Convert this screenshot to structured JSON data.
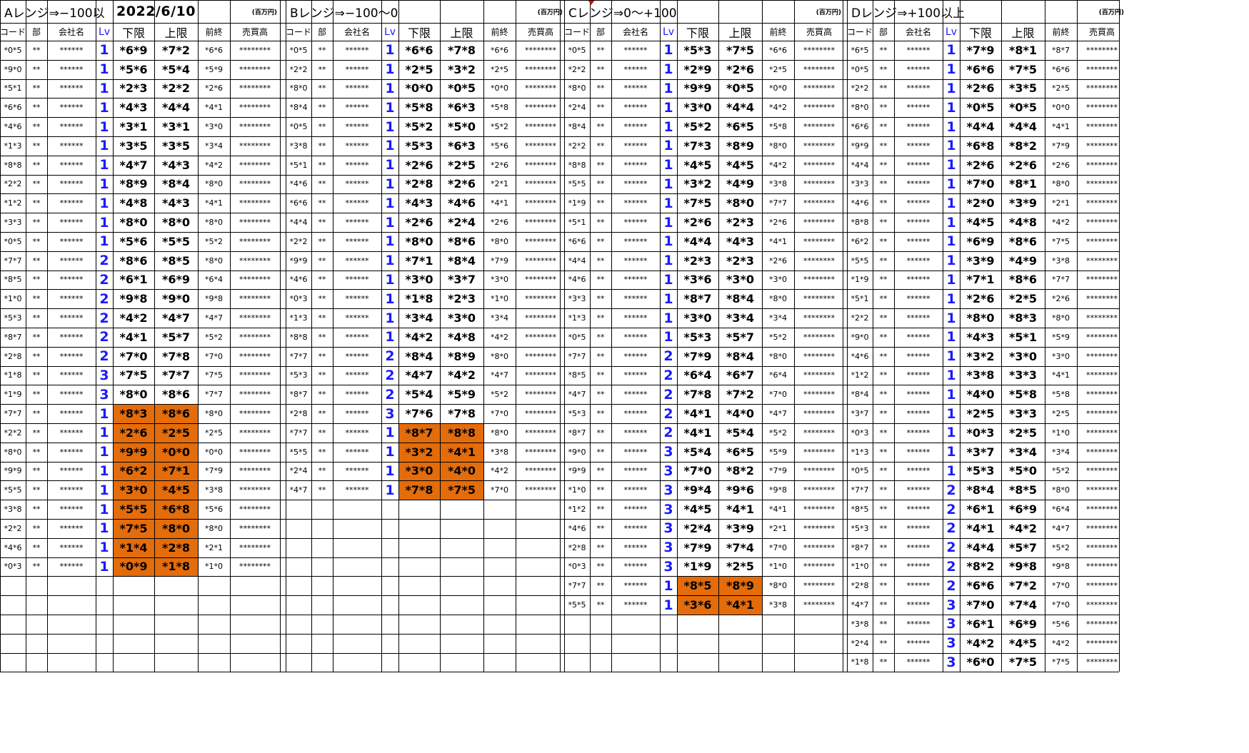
{
  "date": "2022/6/10",
  "unit_label": "(百万円)",
  "columns": [
    "コード",
    "部",
    "会社名",
    "Lv",
    "下限",
    "上限",
    "前終",
    "売買高"
  ],
  "colors": {
    "highlight": "#e46c0a",
    "lv": "#1a1aff",
    "marker": "#e00000"
  },
  "sections": [
    {
      "title": "Aレンジ⇒−100以",
      "rows": [
        [
          "*0*5",
          "**",
          "******",
          "1",
          "*6*9",
          "*7*2",
          "*6*6",
          "********"
        ],
        [
          "*9*0",
          "**",
          "******",
          "1",
          "*5*6",
          "*5*4",
          "*5*9",
          "********"
        ],
        [
          "*5*1",
          "**",
          "******",
          "1",
          "*2*3",
          "*2*2",
          "*2*6",
          "********"
        ],
        [
          "*6*6",
          "**",
          "******",
          "1",
          "*4*3",
          "*4*4",
          "*4*1",
          "********"
        ],
        [
          "*4*6",
          "**",
          "******",
          "1",
          "*3*1",
          "*3*1",
          "*3*0",
          "********"
        ],
        [
          "*1*3",
          "**",
          "******",
          "1",
          "*3*5",
          "*3*5",
          "*3*4",
          "********"
        ],
        [
          "*8*8",
          "**",
          "******",
          "1",
          "*4*7",
          "*4*3",
          "*4*2",
          "********"
        ],
        [
          "*2*2",
          "**",
          "******",
          "1",
          "*8*9",
          "*8*4",
          "*8*0",
          "********"
        ],
        [
          "*1*2",
          "**",
          "******",
          "1",
          "*4*8",
          "*4*3",
          "*4*1",
          "********"
        ],
        [
          "*3*3",
          "**",
          "******",
          "1",
          "*8*0",
          "*8*0",
          "*8*0",
          "********"
        ],
        [
          "*0*5",
          "**",
          "******",
          "1",
          "*5*6",
          "*5*5",
          "*5*2",
          "********"
        ],
        [
          "*7*7",
          "**",
          "******",
          "2",
          "*8*6",
          "*8*5",
          "*8*0",
          "********"
        ],
        [
          "*8*5",
          "**",
          "******",
          "2",
          "*6*1",
          "*6*9",
          "*6*4",
          "********"
        ],
        [
          "*1*0",
          "**",
          "******",
          "2",
          "*9*8",
          "*9*0",
          "*9*8",
          "********"
        ],
        [
          "*5*3",
          "**",
          "******",
          "2",
          "*4*2",
          "*4*7",
          "*4*7",
          "********"
        ],
        [
          "*8*7",
          "**",
          "******",
          "2",
          "*4*1",
          "*5*7",
          "*5*2",
          "********"
        ],
        [
          "*2*8",
          "**",
          "******",
          "2",
          "*7*0",
          "*7*8",
          "*7*0",
          "********"
        ],
        [
          "*1*8",
          "**",
          "******",
          "3",
          "*7*5",
          "*7*7",
          "*7*5",
          "********"
        ],
        [
          "*1*9",
          "**",
          "******",
          "3",
          "*8*0",
          "*8*6",
          "*7*7",
          "********"
        ],
        [
          "*7*7",
          "**",
          "******",
          "1",
          "*8*3",
          "*8*6",
          "*8*0",
          "********",
          true
        ],
        [
          "*2*2",
          "**",
          "******",
          "1",
          "*2*6",
          "*2*5",
          "*2*5",
          "********",
          true
        ],
        [
          "*8*0",
          "**",
          "******",
          "1",
          "*9*9",
          "*0*0",
          "*0*0",
          "********",
          true
        ],
        [
          "*9*9",
          "**",
          "******",
          "1",
          "*6*2",
          "*7*1",
          "*7*9",
          "********",
          true
        ],
        [
          "*5*5",
          "**",
          "******",
          "1",
          "*3*0",
          "*4*5",
          "*3*8",
          "********",
          true
        ],
        [
          "*3*8",
          "**",
          "******",
          "1",
          "*5*5",
          "*6*8",
          "*5*6",
          "********",
          true
        ],
        [
          "*2*2",
          "**",
          "******",
          "1",
          "*7*5",
          "*8*0",
          "*8*0",
          "********",
          true
        ],
        [
          "*4*6",
          "**",
          "******",
          "1",
          "*1*4",
          "*2*8",
          "*2*1",
          "********",
          true
        ],
        [
          "*0*3",
          "**",
          "******",
          "1",
          "*0*9",
          "*1*8",
          "*1*0",
          "********",
          true
        ]
      ]
    },
    {
      "title": "Bレンジ⇒−100〜0",
      "rows": [
        [
          "*0*5",
          "**",
          "******",
          "1",
          "*6*6",
          "*7*8",
          "*6*6",
          "********"
        ],
        [
          "*2*2",
          "**",
          "******",
          "1",
          "*2*5",
          "*3*2",
          "*2*5",
          "********"
        ],
        [
          "*8*0",
          "**",
          "******",
          "1",
          "*0*0",
          "*0*5",
          "*0*0",
          "********"
        ],
        [
          "*8*4",
          "**",
          "******",
          "1",
          "*5*8",
          "*6*3",
          "*5*8",
          "********"
        ],
        [
          "*0*5",
          "**",
          "******",
          "1",
          "*5*2",
          "*5*0",
          "*5*2",
          "********"
        ],
        [
          "*3*8",
          "**",
          "******",
          "1",
          "*5*3",
          "*6*3",
          "*5*6",
          "********"
        ],
        [
          "*5*1",
          "**",
          "******",
          "1",
          "*2*6",
          "*2*5",
          "*2*6",
          "********"
        ],
        [
          "*4*6",
          "**",
          "******",
          "1",
          "*2*8",
          "*2*6",
          "*2*1",
          "********"
        ],
        [
          "*6*6",
          "**",
          "******",
          "1",
          "*4*3",
          "*4*6",
          "*4*1",
          "********"
        ],
        [
          "*4*4",
          "**",
          "******",
          "1",
          "*2*6",
          "*2*4",
          "*2*6",
          "********"
        ],
        [
          "*2*2",
          "**",
          "******",
          "1",
          "*8*0",
          "*8*6",
          "*8*0",
          "********"
        ],
        [
          "*9*9",
          "**",
          "******",
          "1",
          "*7*1",
          "*8*4",
          "*7*9",
          "********"
        ],
        [
          "*4*6",
          "**",
          "******",
          "1",
          "*3*0",
          "*3*7",
          "*3*0",
          "********"
        ],
        [
          "*0*3",
          "**",
          "******",
          "1",
          "*1*8",
          "*2*3",
          "*1*0",
          "********"
        ],
        [
          "*1*3",
          "**",
          "******",
          "1",
          "*3*4",
          "*3*0",
          "*3*4",
          "********"
        ],
        [
          "*8*8",
          "**",
          "******",
          "1",
          "*4*2",
          "*4*8",
          "*4*2",
          "********"
        ],
        [
          "*7*7",
          "**",
          "******",
          "2",
          "*8*4",
          "*8*9",
          "*8*0",
          "********"
        ],
        [
          "*5*3",
          "**",
          "******",
          "2",
          "*4*7",
          "*4*2",
          "*4*7",
          "********"
        ],
        [
          "*8*7",
          "**",
          "******",
          "2",
          "*5*4",
          "*5*9",
          "*5*2",
          "********"
        ],
        [
          "*2*8",
          "**",
          "******",
          "3",
          "*7*6",
          "*7*8",
          "*7*0",
          "********"
        ],
        [
          "*7*7",
          "**",
          "******",
          "1",
          "*8*7",
          "*8*8",
          "*8*0",
          "********",
          true
        ],
        [
          "*5*5",
          "**",
          "******",
          "1",
          "*3*2",
          "*4*1",
          "*3*8",
          "********",
          true
        ],
        [
          "*2*4",
          "**",
          "******",
          "1",
          "*3*0",
          "*4*0",
          "*4*2",
          "********",
          true
        ],
        [
          "*4*7",
          "**",
          "******",
          "1",
          "*7*8",
          "*7*5",
          "*7*0",
          "********",
          true
        ]
      ]
    },
    {
      "title": "Cレンジ⇒0〜+100",
      "rows": [
        [
          "*0*5",
          "**",
          "******",
          "1",
          "*5*3",
          "*7*5",
          "*6*6",
          "********"
        ],
        [
          "*2*2",
          "**",
          "******",
          "1",
          "*2*9",
          "*2*6",
          "*2*5",
          "********"
        ],
        [
          "*8*0",
          "**",
          "******",
          "1",
          "*9*9",
          "*0*5",
          "*0*0",
          "********"
        ],
        [
          "*2*4",
          "**",
          "******",
          "1",
          "*3*0",
          "*4*4",
          "*4*2",
          "********"
        ],
        [
          "*8*4",
          "**",
          "******",
          "1",
          "*5*2",
          "*6*5",
          "*5*8",
          "********"
        ],
        [
          "*2*2",
          "**",
          "******",
          "1",
          "*7*3",
          "*8*9",
          "*8*0",
          "********"
        ],
        [
          "*8*8",
          "**",
          "******",
          "1",
          "*4*5",
          "*4*5",
          "*4*2",
          "********"
        ],
        [
          "*5*5",
          "**",
          "******",
          "1",
          "*3*2",
          "*4*9",
          "*3*8",
          "********"
        ],
        [
          "*1*9",
          "**",
          "******",
          "1",
          "*7*5",
          "*8*0",
          "*7*7",
          "********"
        ],
        [
          "*5*1",
          "**",
          "******",
          "1",
          "*2*6",
          "*2*3",
          "*2*6",
          "********"
        ],
        [
          "*6*6",
          "**",
          "******",
          "1",
          "*4*4",
          "*4*3",
          "*4*1",
          "********"
        ],
        [
          "*4*4",
          "**",
          "******",
          "1",
          "*2*3",
          "*2*3",
          "*2*6",
          "********"
        ],
        [
          "*4*6",
          "**",
          "******",
          "1",
          "*3*6",
          "*3*0",
          "*3*0",
          "********"
        ],
        [
          "*3*3",
          "**",
          "******",
          "1",
          "*8*7",
          "*8*4",
          "*8*0",
          "********"
        ],
        [
          "*1*3",
          "**",
          "******",
          "1",
          "*3*0",
          "*3*4",
          "*3*4",
          "********"
        ],
        [
          "*0*5",
          "**",
          "******",
          "1",
          "*5*3",
          "*5*7",
          "*5*2",
          "********"
        ],
        [
          "*7*7",
          "**",
          "******",
          "2",
          "*7*9",
          "*8*4",
          "*8*0",
          "********"
        ],
        [
          "*8*5",
          "**",
          "******",
          "2",
          "*6*4",
          "*6*7",
          "*6*4",
          "********"
        ],
        [
          "*4*7",
          "**",
          "******",
          "2",
          "*7*8",
          "*7*2",
          "*7*0",
          "********"
        ],
        [
          "*5*3",
          "**",
          "******",
          "2",
          "*4*1",
          "*4*0",
          "*4*7",
          "********"
        ],
        [
          "*8*7",
          "**",
          "******",
          "2",
          "*4*1",
          "*5*4",
          "*5*2",
          "********"
        ],
        [
          "*9*0",
          "**",
          "******",
          "3",
          "*5*4",
          "*6*5",
          "*5*9",
          "********"
        ],
        [
          "*9*9",
          "**",
          "******",
          "3",
          "*7*0",
          "*8*2",
          "*7*9",
          "********"
        ],
        [
          "*1*0",
          "**",
          "******",
          "3",
          "*9*4",
          "*9*6",
          "*9*8",
          "********"
        ],
        [
          "*1*2",
          "**",
          "******",
          "3",
          "*4*5",
          "*4*1",
          "*4*1",
          "********"
        ],
        [
          "*4*6",
          "**",
          "******",
          "3",
          "*2*4",
          "*3*9",
          "*2*1",
          "********"
        ],
        [
          "*2*8",
          "**",
          "******",
          "3",
          "*7*9",
          "*7*4",
          "*7*0",
          "********"
        ],
        [
          "*0*3",
          "**",
          "******",
          "3",
          "*1*9",
          "*2*5",
          "*1*0",
          "********"
        ],
        [
          "*7*7",
          "**",
          "******",
          "1",
          "*8*5",
          "*8*9",
          "*8*0",
          "********",
          true
        ],
        [
          "*5*5",
          "**",
          "******",
          "1",
          "*3*6",
          "*4*1",
          "*3*8",
          "********",
          true
        ]
      ]
    },
    {
      "title": "Dレンジ⇒+100以上",
      "rows": [
        [
          "*6*5",
          "**",
          "******",
          "1",
          "*7*9",
          "*8*1",
          "*8*7",
          "********"
        ],
        [
          "*0*5",
          "**",
          "******",
          "1",
          "*6*6",
          "*7*5",
          "*6*6",
          "********"
        ],
        [
          "*2*2",
          "**",
          "******",
          "1",
          "*2*6",
          "*3*5",
          "*2*5",
          "********"
        ],
        [
          "*8*0",
          "**",
          "******",
          "1",
          "*0*5",
          "*0*5",
          "*0*0",
          "********"
        ],
        [
          "*6*6",
          "**",
          "******",
          "1",
          "*4*4",
          "*4*4",
          "*4*1",
          "********"
        ],
        [
          "*9*9",
          "**",
          "******",
          "1",
          "*6*8",
          "*8*2",
          "*7*9",
          "********"
        ],
        [
          "*4*4",
          "**",
          "******",
          "1",
          "*2*6",
          "*2*6",
          "*2*6",
          "********"
        ],
        [
          "*3*3",
          "**",
          "******",
          "1",
          "*7*0",
          "*8*1",
          "*8*0",
          "********"
        ],
        [
          "*4*6",
          "**",
          "******",
          "1",
          "*2*0",
          "*3*9",
          "*2*1",
          "********"
        ],
        [
          "*8*8",
          "**",
          "******",
          "1",
          "*4*5",
          "*4*8",
          "*4*2",
          "********"
        ],
        [
          "*6*2",
          "**",
          "******",
          "1",
          "*6*9",
          "*8*6",
          "*7*5",
          "********"
        ],
        [
          "*5*5",
          "**",
          "******",
          "1",
          "*3*9",
          "*4*9",
          "*3*8",
          "********"
        ],
        [
          "*1*9",
          "**",
          "******",
          "1",
          "*7*1",
          "*8*6",
          "*7*7",
          "********"
        ],
        [
          "*5*1",
          "**",
          "******",
          "1",
          "*2*6",
          "*2*5",
          "*2*6",
          "********"
        ],
        [
          "*2*2",
          "**",
          "******",
          "1",
          "*8*0",
          "*8*3",
          "*8*0",
          "********"
        ],
        [
          "*9*0",
          "**",
          "******",
          "1",
          "*4*3",
          "*5*1",
          "*5*9",
          "********"
        ],
        [
          "*4*6",
          "**",
          "******",
          "1",
          "*3*2",
          "*3*0",
          "*3*0",
          "********"
        ],
        [
          "*1*2",
          "**",
          "******",
          "1",
          "*3*8",
          "*3*3",
          "*4*1",
          "********"
        ],
        [
          "*8*4",
          "**",
          "******",
          "1",
          "*4*0",
          "*5*8",
          "*5*8",
          "********"
        ],
        [
          "*3*7",
          "**",
          "******",
          "1",
          "*2*5",
          "*3*3",
          "*2*5",
          "********"
        ],
        [
          "*0*3",
          "**",
          "******",
          "1",
          "*0*3",
          "*2*5",
          "*1*0",
          "********"
        ],
        [
          "*1*3",
          "**",
          "******",
          "1",
          "*3*7",
          "*3*4",
          "*3*4",
          "********"
        ],
        [
          "*0*5",
          "**",
          "******",
          "1",
          "*5*3",
          "*5*0",
          "*5*2",
          "********"
        ],
        [
          "*7*7",
          "**",
          "******",
          "2",
          "*8*4",
          "*8*5",
          "*8*0",
          "********"
        ],
        [
          "*8*5",
          "**",
          "******",
          "2",
          "*6*1",
          "*6*9",
          "*6*4",
          "********"
        ],
        [
          "*5*3",
          "**",
          "******",
          "2",
          "*4*1",
          "*4*2",
          "*4*7",
          "********"
        ],
        [
          "*8*7",
          "**",
          "******",
          "2",
          "*4*4",
          "*5*7",
          "*5*2",
          "********"
        ],
        [
          "*1*0",
          "**",
          "******",
          "2",
          "*8*2",
          "*9*8",
          "*9*8",
          "********"
        ],
        [
          "*2*8",
          "**",
          "******",
          "2",
          "*6*6",
          "*7*2",
          "*7*0",
          "********"
        ],
        [
          "*4*7",
          "**",
          "******",
          "3",
          "*7*0",
          "*7*4",
          "*7*0",
          "********"
        ],
        [
          "*3*8",
          "**",
          "******",
          "3",
          "*6*1",
          "*6*9",
          "*5*6",
          "********"
        ],
        [
          "*2*4",
          "**",
          "******",
          "3",
          "*4*2",
          "*4*5",
          "*4*2",
          "********"
        ],
        [
          "*1*8",
          "**",
          "******",
          "3",
          "*6*0",
          "*7*5",
          "*7*5",
          "********"
        ]
      ]
    }
  ]
}
